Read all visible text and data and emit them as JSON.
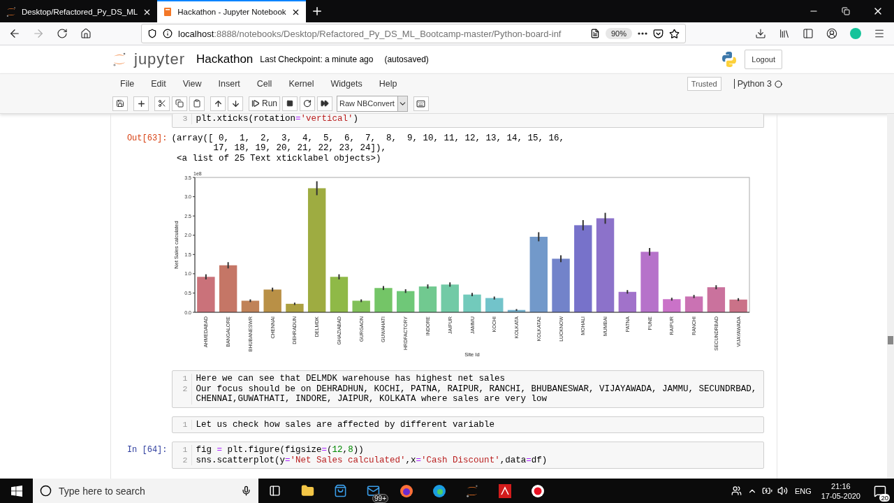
{
  "browser": {
    "tabs": [
      {
        "title": "Desktop/Refactored_Py_DS_ML",
        "selected": false,
        "kind": "jupyter"
      },
      {
        "title": "Hackathon - Jupyter Notebook",
        "selected": true,
        "kind": "notebook"
      }
    ],
    "url": {
      "host": "localhost",
      "path": ":8888/notebooks/Desktop/Refactored_Py_DS_ML_Bootcamp-master/Python-board-inf"
    },
    "zoom": "90%"
  },
  "notebook": {
    "logo": "jupyter",
    "name": "Hackathon",
    "checkpoint": "Last Checkpoint: a minute ago",
    "autosave": "(autosaved)",
    "logout": "Logout",
    "menu": [
      "File",
      "Edit",
      "View",
      "Insert",
      "Cell",
      "Kernel",
      "Widgets",
      "Help"
    ],
    "trusted": "Trusted",
    "kernel": "Python 3",
    "run_label": "Run",
    "cell_type": "Raw NBConvert"
  },
  "cells": [
    {
      "kind": "code",
      "cut_top": true,
      "lines": [
        {
          "n": "3",
          "text": "plt.xticks(rotation='vertical')"
        }
      ]
    },
    {
      "kind": "output",
      "prompt": "Out[63]:",
      "lines": [
        "(array([ 0,  1,  2,  3,  4,  5,  6,  7,  8,  9, 10, 11, 12, 13, 14, 15, 16,",
        "        17, 18, 19, 20, 21, 22, 23, 24]),",
        " <a list of 25 Text xticklabel objects>)"
      ],
      "chart_data": {
        "type": "bar",
        "xlabel": "Site Id",
        "ylabel": "Net Sales calculated",
        "categories": [
          "AHMEDABAD",
          "BANGALORE",
          "BHUBANESWR",
          "CHENNAI",
          "DEHRADUN",
          "DELMDK",
          "GHAZIABAD",
          "GURGAON",
          "GUWAHATI",
          "HRDFACTORY",
          "INDORE",
          "JAIPUR",
          "JAMMU",
          "KOCHI",
          "KOLKATA",
          "KOLKATA2",
          "LUCKNOW",
          "MOHALI",
          "MUMBAI",
          "PATNA",
          "PUNE",
          "RAIPUR",
          "RANCHI",
          "SECUNDRBAD",
          "VIJAYAWADA"
        ],
        "values": [
          0.92,
          1.22,
          0.3,
          0.59,
          0.22,
          3.22,
          0.92,
          0.3,
          0.63,
          0.55,
          0.67,
          0.72,
          0.46,
          0.37,
          0.06,
          1.96,
          1.39,
          2.26,
          2.44,
          0.53,
          1.57,
          0.34,
          0.41,
          0.65,
          0.33
        ],
        "ylim": [
          0,
          3.5
        ],
        "yticks": [
          {
            "value": 0,
            "label": "0.0"
          },
          {
            "value": 0.5,
            "label": "0.5"
          },
          {
            "value": 1,
            "label": "1.0"
          },
          {
            "value": 1.5,
            "label": "1.5"
          },
          {
            "value": 2,
            "label": "2.0"
          },
          {
            "value": 2.5,
            "label": "2.5"
          },
          {
            "value": 3,
            "label": "3.0"
          },
          {
            "value": 3.5,
            "label": "3.5"
          }
        ],
        "annotations": [
          {
            "text": "1e8"
          }
        ]
      }
    },
    {
      "kind": "raw",
      "lines": [
        {
          "n": "1",
          "text": "Here we can see that DELMDK warehouse has highest net sales"
        },
        {
          "n": "2",
          "text": "Our focus should be on DEHRADHUN, KOCHI, PATNA, RAIPUR, RANCHI, BHUBANESWAR, VIJAYAWADA, JAMMU, SECUNDRBAD,"
        },
        {
          "text": "CHENNAI,GUWATHATI, INDORE, JAIPUR, KOLKATA where sales are very low"
        }
      ]
    },
    {
      "kind": "raw",
      "lines": [
        {
          "n": "1",
          "text": "Let us check how sales are affected by different variable"
        }
      ]
    },
    {
      "kind": "code",
      "prompt": "In [64]:",
      "lines": [
        {
          "n": "1",
          "text": "fig = plt.figure(figsize=(12,8))"
        },
        {
          "n": "2",
          "text": "sns.scatterplot(y='Net Sales calculated',x='Cash Discount',data=df)"
        }
      ]
    }
  ],
  "taskbar": {
    "search_placeholder": "Type here to search",
    "mail_badge": "99+",
    "language": "ENG",
    "time": "21:16",
    "date": "17-05-2020",
    "notifications": "20"
  }
}
